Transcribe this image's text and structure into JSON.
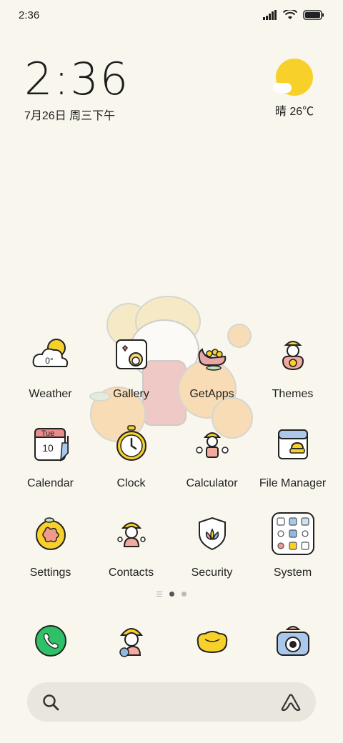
{
  "status_bar": {
    "time": "2:36"
  },
  "clock_widget": {
    "time": "2:36",
    "date": "7月26日 周三下午"
  },
  "weather_widget": {
    "condition_temp": "晴 26℃"
  },
  "apps": [
    [
      {
        "label": "Weather",
        "icon": "weather-icon",
        "badge": "0°"
      },
      {
        "label": "Gallery",
        "icon": "gallery-icon"
      },
      {
        "label": "GetApps",
        "icon": "getapps-icon"
      },
      {
        "label": "Themes",
        "icon": "themes-icon"
      }
    ],
    [
      {
        "label": "Calendar",
        "icon": "calendar-icon",
        "day": "Tue",
        "date": "10"
      },
      {
        "label": "Clock",
        "icon": "clock-icon"
      },
      {
        "label": "Calculator",
        "icon": "calculator-icon"
      },
      {
        "label": "File Manager",
        "icon": "file-manager-icon"
      }
    ],
    [
      {
        "label": "Settings",
        "icon": "settings-icon"
      },
      {
        "label": "Contacts",
        "icon": "contacts-icon"
      },
      {
        "label": "Security",
        "icon": "security-icon"
      },
      {
        "label": "System",
        "icon": "system-folder-icon"
      }
    ]
  ],
  "dock": [
    {
      "icon": "phone-icon"
    },
    {
      "icon": "messages-icon"
    },
    {
      "icon": "browser-icon"
    },
    {
      "icon": "camera-icon"
    }
  ],
  "page_indicator": {
    "pages": 2,
    "current": 1
  },
  "search": {
    "placeholder": ""
  },
  "colors": {
    "background": "#f8f6ed",
    "sun": "#f7d02a",
    "phone": "#2ec167",
    "search_bg": "#e9e7dd"
  }
}
